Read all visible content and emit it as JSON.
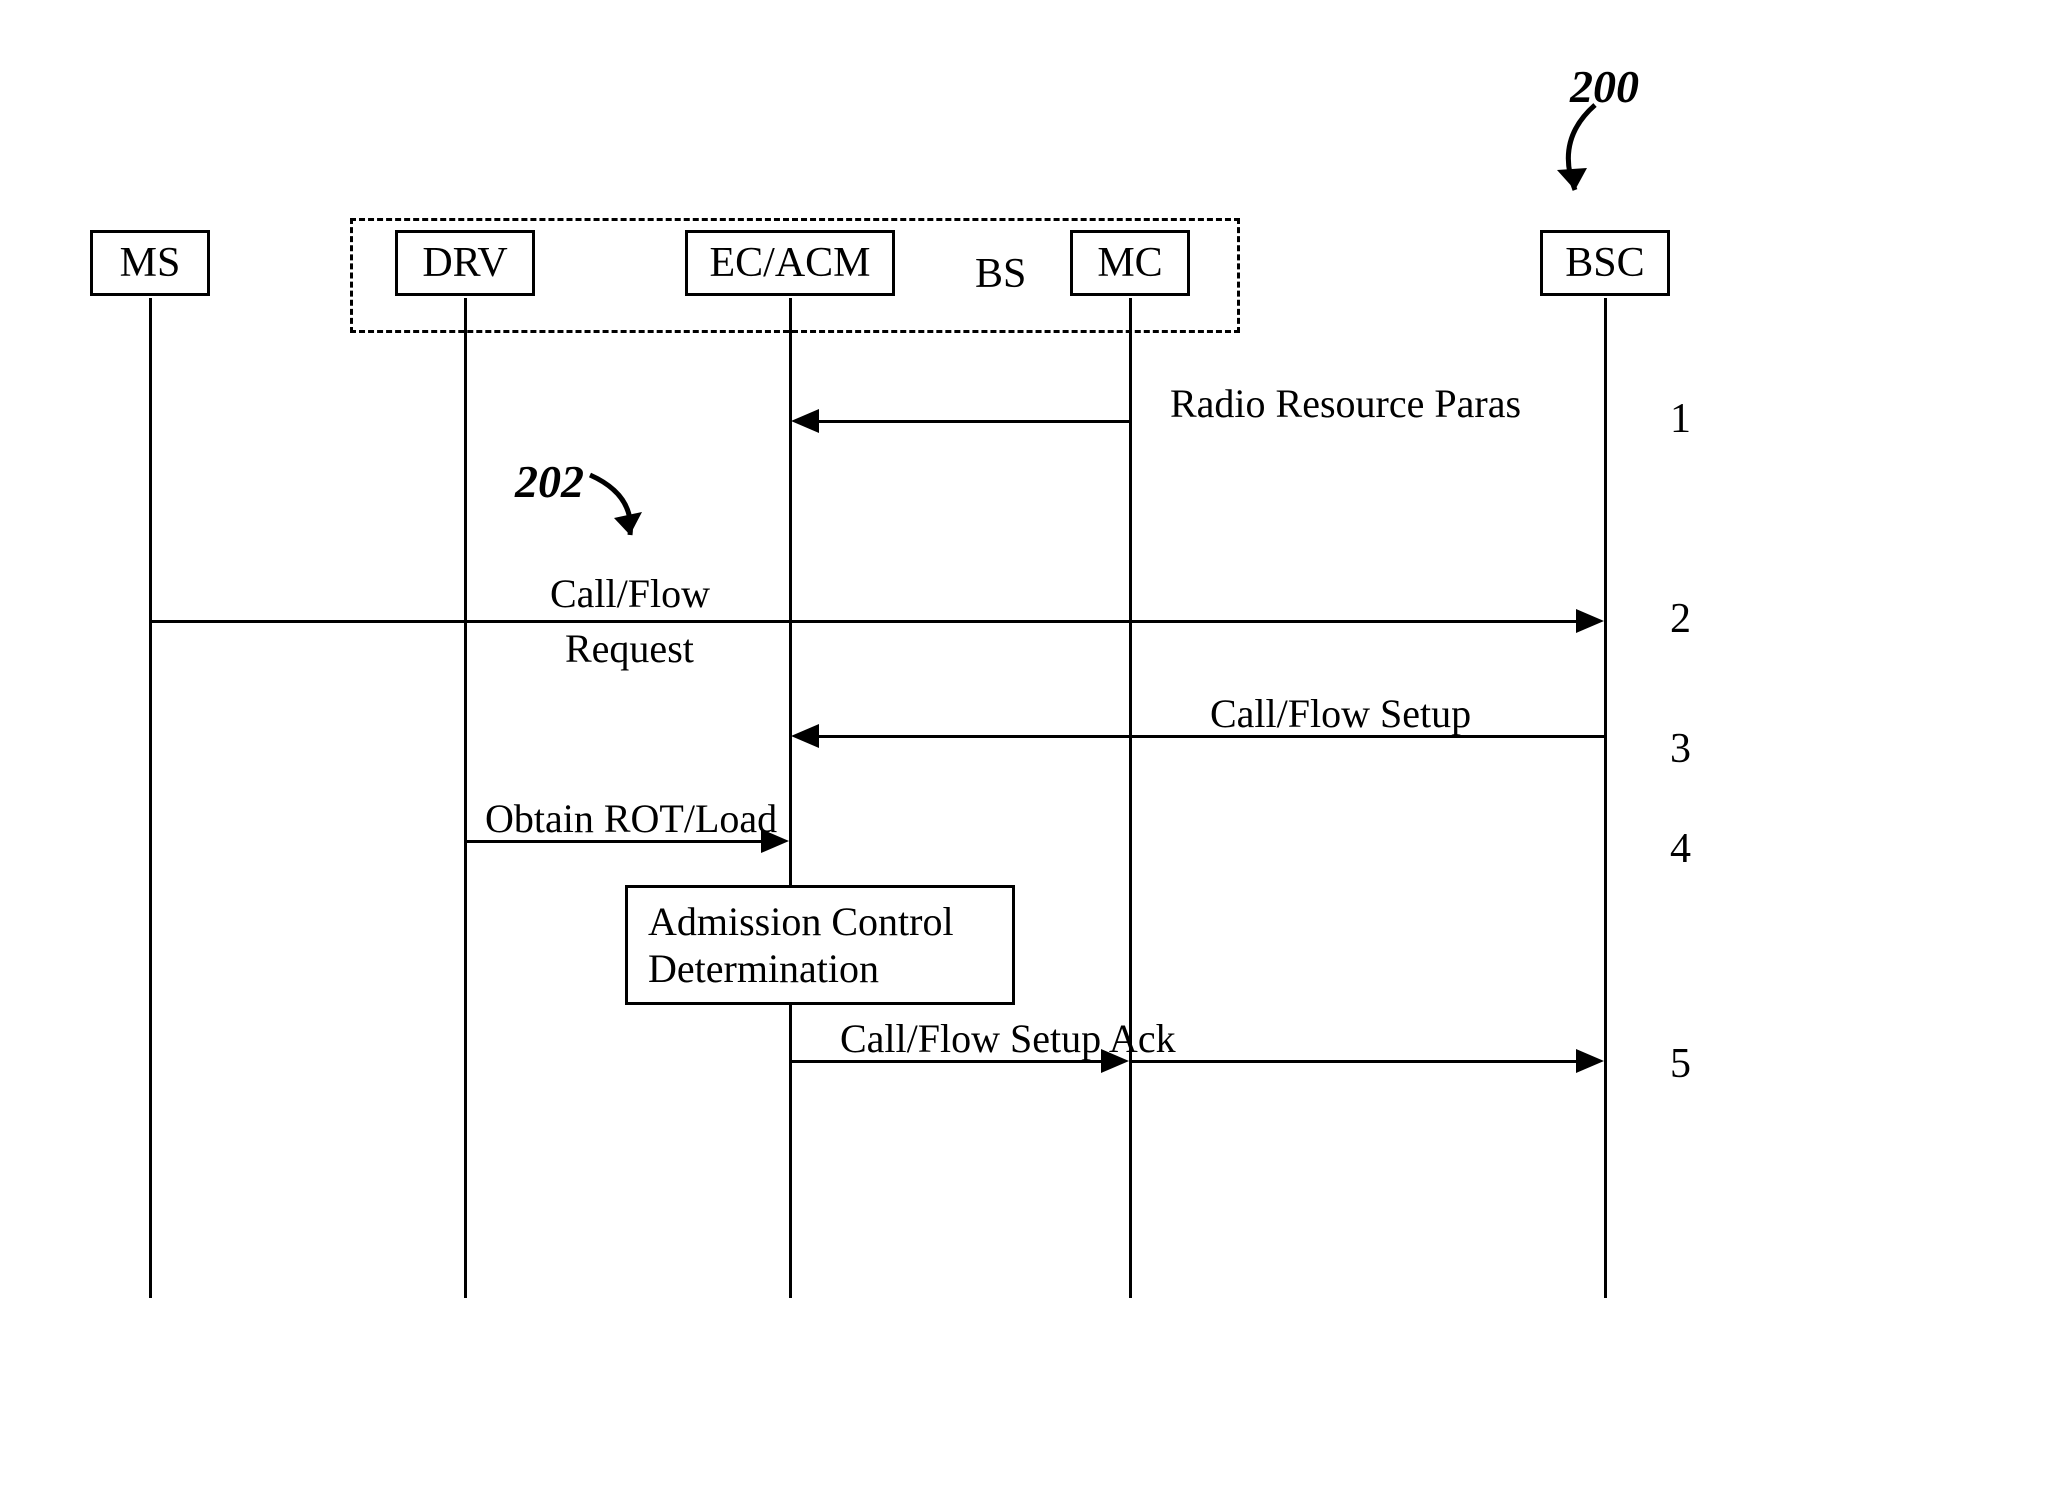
{
  "figure_ref": "200",
  "callout_ref": "202",
  "participants": {
    "ms": "MS",
    "drv": "DRV",
    "ecacm": "EC/ACM",
    "bs": "BS",
    "mc": "MC",
    "bsc": "BSC"
  },
  "messages": {
    "m1": "Radio Resource Paras",
    "m2_line1": "Call/Flow",
    "m2_line2": "Request",
    "m3": "Call/Flow Setup",
    "m4": "Obtain ROT/Load",
    "m5": "Call/Flow Setup Ack",
    "process_line1": "Admission Control",
    "process_line2": "Determination"
  },
  "steps": {
    "s1": "1",
    "s2": "2",
    "s3": "3",
    "s4": "4",
    "s5": "5"
  },
  "chart_data": {
    "type": "sequence-diagram",
    "participants": [
      "MS",
      "DRV",
      "EC/ACM",
      "MC",
      "BSC"
    ],
    "group": {
      "name": "BS",
      "members": [
        "DRV",
        "EC/ACM",
        "MC"
      ]
    },
    "steps": [
      {
        "n": 1,
        "from": "MC",
        "to": "EC/ACM",
        "label": "Radio Resource Paras",
        "direction": "left"
      },
      {
        "n": 2,
        "from": "MS",
        "to": "BSC",
        "label": "Call/Flow Request",
        "direction": "right"
      },
      {
        "n": 3,
        "from": "BSC",
        "to": "EC/ACM",
        "label": "Call/Flow Setup",
        "direction": "left"
      },
      {
        "n": 4,
        "from": "DRV",
        "to": "EC/ACM",
        "label": "Obtain ROT/Load",
        "direction": "right"
      },
      {
        "n": null,
        "at": "EC/ACM",
        "type": "process",
        "label": "Admission Control Determination"
      },
      {
        "n": 5,
        "from": "EC/ACM",
        "to": "BSC",
        "via": "MC",
        "label": "Call/Flow Setup Ack",
        "direction": "right"
      }
    ],
    "callouts": [
      {
        "ref": "200",
        "target": "diagram"
      },
      {
        "ref": "202",
        "target": "step 2 label"
      }
    ]
  }
}
